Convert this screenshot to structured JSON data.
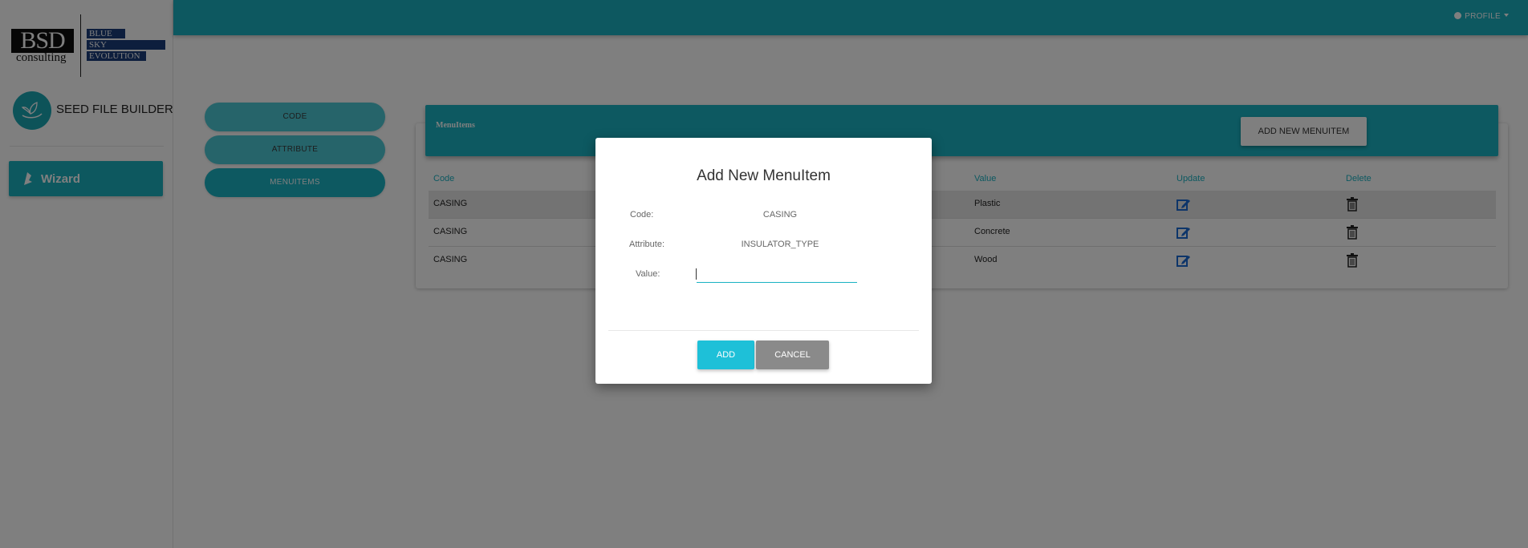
{
  "sidebar": {
    "logo": {
      "main": "BSD",
      "sub": "consulting",
      "lines": [
        "BLUE",
        "SKY",
        "EVOLUTION"
      ]
    },
    "app_title": "SEED FILE BUILDER",
    "app_icon": "seed-leaf-icon",
    "nav": [
      {
        "label": "Wizard",
        "icon": "wand-icon"
      }
    ]
  },
  "topbar": {
    "profile_label": "PROFILE",
    "accent": "#1ab0c0"
  },
  "steps": [
    {
      "label": "CODE"
    },
    {
      "label": "ATTRIBUTE"
    },
    {
      "label": "MENUITEMS",
      "active": true
    }
  ],
  "card": {
    "title": "MenuItems",
    "add_button": "ADD NEW MENUITEM",
    "columns": [
      "Code",
      "Value",
      "Update",
      "Delete"
    ],
    "rows": [
      {
        "code": "CASING",
        "value": "Plastic"
      },
      {
        "code": "CASING",
        "value": "Concrete"
      },
      {
        "code": "CASING",
        "value": "Wood"
      }
    ]
  },
  "modal": {
    "title": "Add New MenuItem",
    "fields": [
      {
        "label": "Code:",
        "value": "CASING"
      },
      {
        "label": "Attribute:",
        "value": "INSULATOR_TYPE"
      },
      {
        "label": "Value:",
        "value": ""
      }
    ],
    "add_label": "ADD",
    "cancel_label": "CANCEL"
  }
}
